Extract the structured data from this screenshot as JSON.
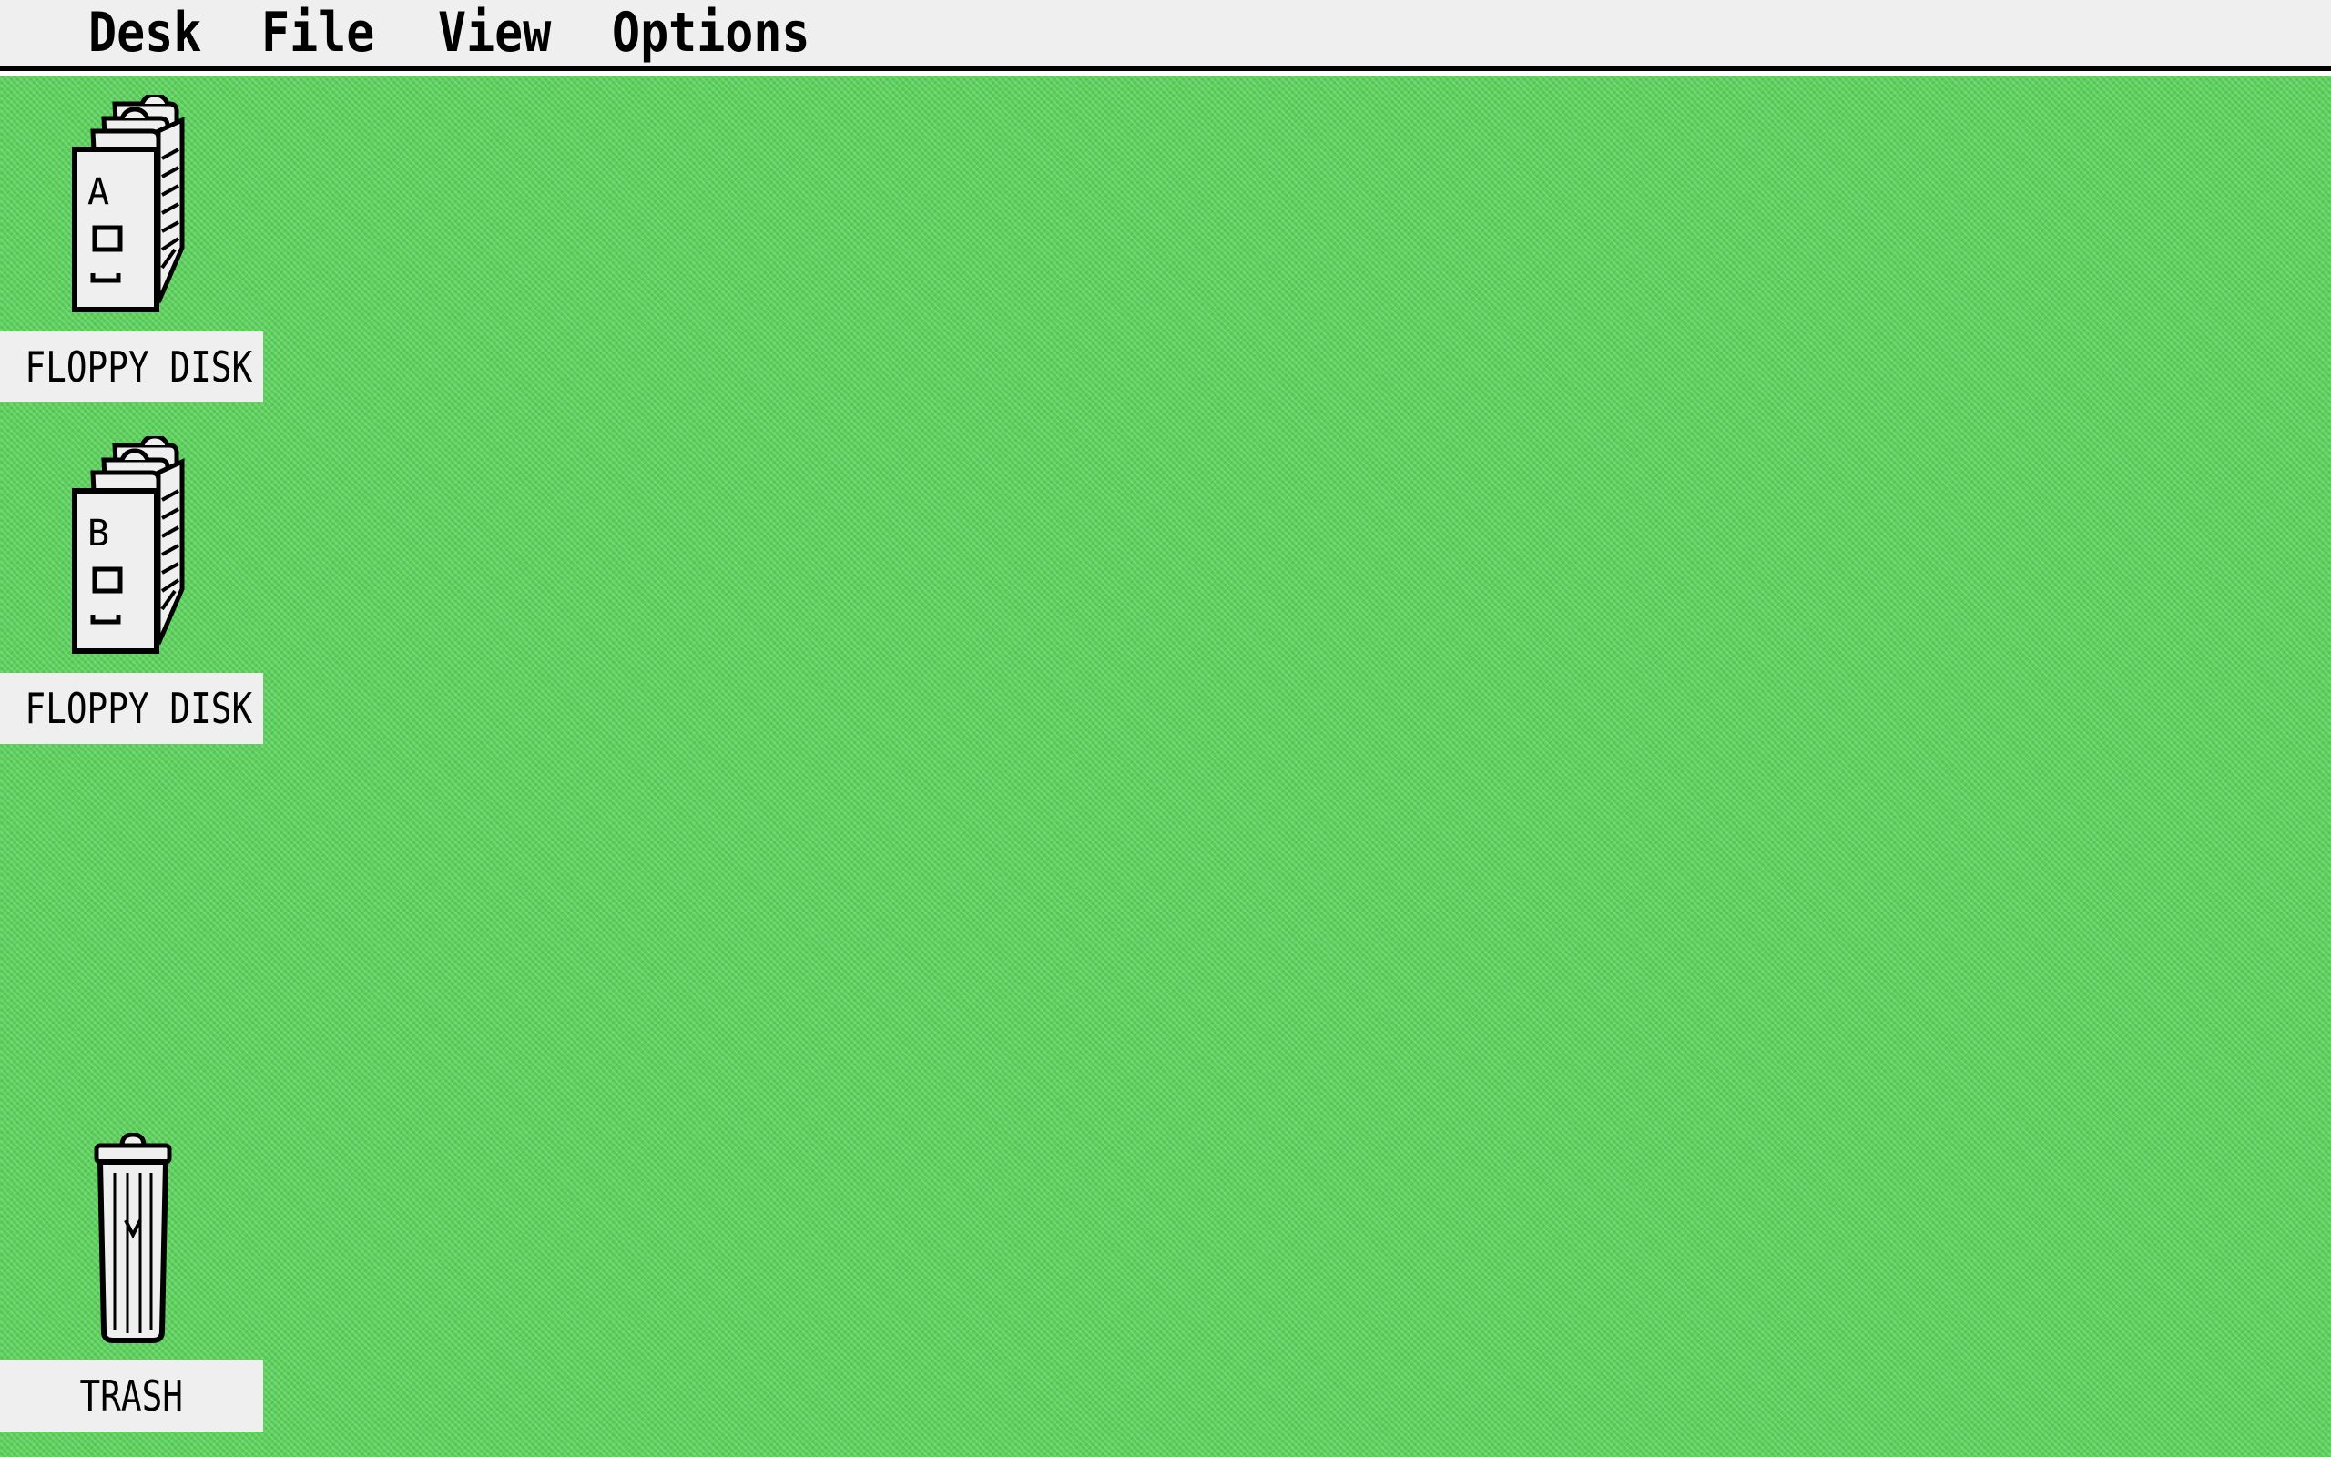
{
  "menubar": {
    "items": [
      {
        "label": "Desk"
      },
      {
        "label": "File"
      },
      {
        "label": "View"
      },
      {
        "label": "Options"
      }
    ]
  },
  "desktop": {
    "background_color": "#5bd05b",
    "icons": [
      {
        "label": "FLOPPY DISK",
        "icon": "floppy-drive-icon",
        "drive_letter": "A"
      },
      {
        "label": "FLOPPY DISK",
        "icon": "floppy-drive-icon",
        "drive_letter": "B"
      },
      {
        "label": "TRASH",
        "icon": "trash-can-icon"
      }
    ]
  }
}
